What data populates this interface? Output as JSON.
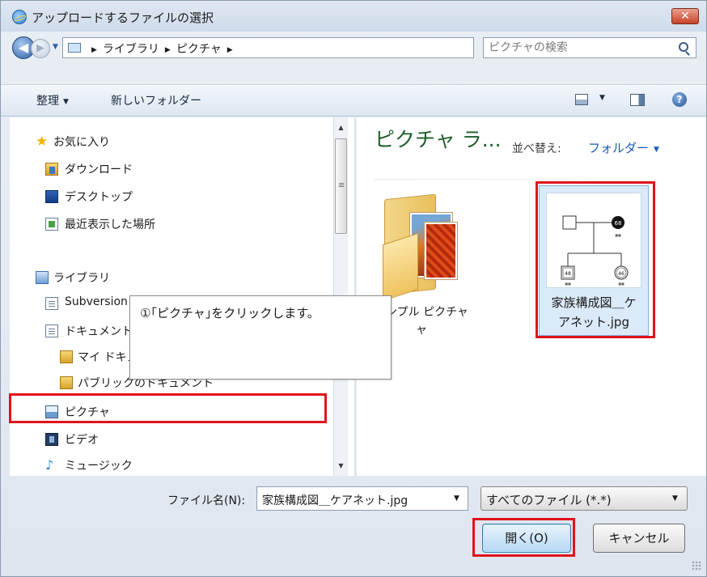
{
  "window": {
    "title": "アップロードするファイルの選択",
    "close_label": "✕"
  },
  "nav": {
    "back_glyph": "◀",
    "forward_glyph": "▶",
    "breadcrumbs": [
      "ライブラリ",
      "ピクチャ"
    ],
    "search_placeholder": "ピクチャの検索"
  },
  "toolbar": {
    "organize_label": "整理",
    "new_folder_label": "新しいフォルダー",
    "help_glyph": "?"
  },
  "navpane": {
    "items": [
      {
        "label": "お気に入り",
        "icon": "star-icon"
      },
      {
        "label": "ダウンロード",
        "icon": "downloads-folder-icon"
      },
      {
        "label": "デスクトップ",
        "icon": "desktop-icon"
      },
      {
        "label": "最近表示した場所",
        "icon": "recent-places-icon"
      },
      {
        "label": "ライブラリ",
        "icon": "library-icon"
      },
      {
        "label": "Subversion",
        "icon": "document-icon"
      },
      {
        "label": "ドキュメント",
        "icon": "document-icon"
      },
      {
        "label": "マイ ドキュメント",
        "icon": "folder-icon"
      },
      {
        "label": "パブリックのドキュメント",
        "icon": "folder-icon"
      },
      {
        "label": "ピクチャ",
        "icon": "pictures-icon"
      },
      {
        "label": "ビデオ",
        "icon": "video-icon"
      },
      {
        "label": "ミュージック",
        "icon": "music-icon"
      }
    ]
  },
  "content": {
    "title": "ピクチャ ラ...",
    "arrange_label": "並べ替え:",
    "arrange_value": "フォルダー",
    "items": [
      {
        "name_line1": "サンプル ピクチャ",
        "name_line2": "ャ"
      },
      {
        "name_line1": "家族構成図＿ケ",
        "name_line2": "アネット.jpg"
      }
    ]
  },
  "footer": {
    "filename_label": "ファイル名(N):",
    "filename_value": "家族構成図＿ケアネット.jpg",
    "filetype_value": "すべてのファイル (*.*)",
    "open_label": "開く(O)",
    "cancel_label": "キャンセル"
  },
  "annotation": {
    "callout_text": "①｢ピクチャ｣をクリックします。",
    "highlight_color": "#e0131b"
  },
  "genogram": {
    "circle_top": "68",
    "square_bottom": "48",
    "circle_bottom": "46"
  }
}
